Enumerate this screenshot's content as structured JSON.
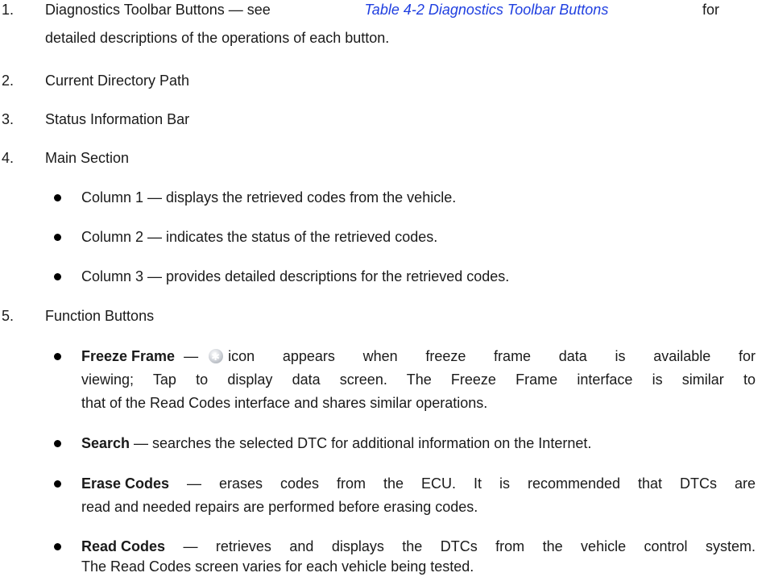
{
  "items": [
    {
      "num": "1.",
      "line1_pre": "Diagnostics Toolbar Buttons — see",
      "line1_link": "Table 4-2 Diagnostics Toolbar Buttons",
      "line1_post": "for",
      "line2": "detailed descriptions of the operations of each button."
    },
    {
      "num": "2.",
      "text": "Current Directory Path"
    },
    {
      "num": "3.",
      "text": "Status Information Bar"
    },
    {
      "num": "4.",
      "text": "Main Section"
    },
    {
      "num": "5.",
      "text": "Function Buttons"
    }
  ],
  "columns": [
    "Column 1 — displays the retrieved codes from the vehicle.",
    "Column 2 — indicates the status of the retrieved codes.",
    "Column 3 — provides detailed descriptions for the retrieved codes."
  ],
  "functions": {
    "freeze": {
      "label": "Freeze Frame",
      "dash": "—",
      "icon": "snowflake-icon",
      "l1": "icon appears when freeze frame data is available for",
      "l2": "viewing; Tap to display data screen. The Freeze Frame interface is similar to",
      "l3": "that of the Read Codes interface and shares similar operations."
    },
    "search": {
      "label": "Search",
      "rest": " — searches the selected DTC for additional information on the Internet."
    },
    "erase": {
      "label": "Erase Codes",
      "l1": " — erases codes from the ECU. It is recommended that DTCs are",
      "l2": "read and needed repairs are performed before erasing codes."
    },
    "read": {
      "label": "Read Codes",
      "l1": " — retrieves and displays the DTCs from the vehicle control system.",
      "l2": "The Read Codes screen varies for each vehicle being tested."
    }
  }
}
